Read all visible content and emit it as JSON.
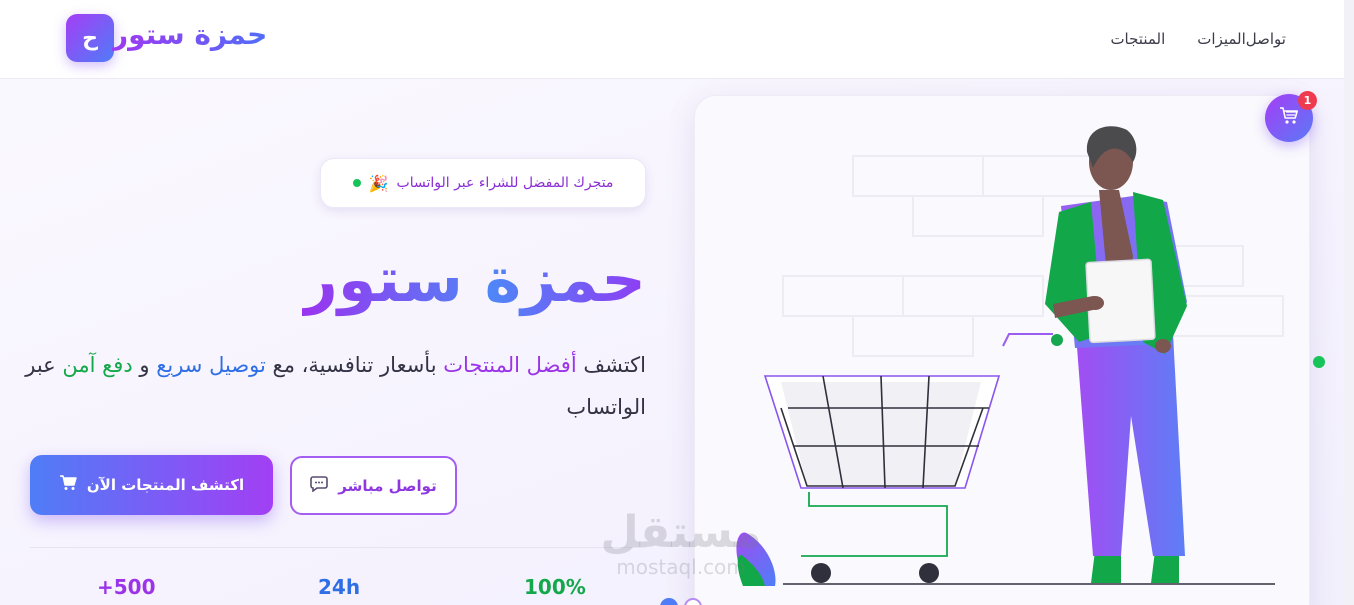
{
  "header": {
    "brand": "حمزة ستور",
    "logo_letter": "ح",
    "nav": [
      "تواصل",
      "الميزات",
      "المنتجات"
    ]
  },
  "hero": {
    "pill_text": "متجرك المفضل للشراء عبر الواتساب",
    "pill_emoji": "🎉",
    "title": "حمزة ستور",
    "subtitle": {
      "p1": "اكتشف ",
      "p2": "أفضل المنتجات",
      "p3": " بأسعار تنافسية، مع ",
      "p4": "توصيل سريع",
      "p5": " و ",
      "p6": "دفع آمن",
      "p7": " عبر الواتساب"
    },
    "btn_contact": "تواصل مباشر",
    "btn_shop": "اكتشف المنتجات الآن"
  },
  "stats": [
    "+500",
    "24h",
    "100%"
  ],
  "cart": {
    "count": "1"
  },
  "watermark": {
    "ar": "مستقل",
    "en": "mostaql.com"
  },
  "colors": {
    "purple": "#9b34e8",
    "blue": "#4f7df7",
    "green": "#16c45a",
    "badge_red": "#ef3b4f"
  },
  "icons": [
    "cart-icon",
    "chat-icon",
    "party-icon"
  ]
}
